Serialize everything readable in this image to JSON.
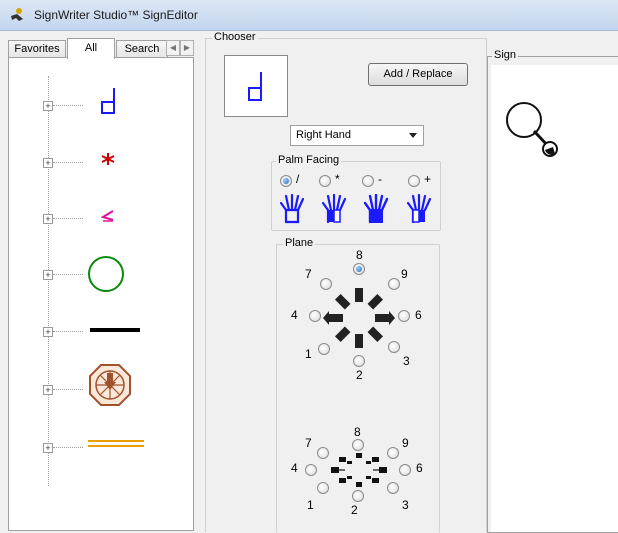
{
  "window": {
    "title": "SignWriter Studio™ SignEditor",
    "icon": "signwriter-app-icon"
  },
  "tabs": {
    "favorites": "Favorites",
    "all": "All",
    "search": "Search",
    "active": "All"
  },
  "symbol_tree": {
    "items": [
      {
        "name": "hand-symbol",
        "color": "#1a1aff"
      },
      {
        "name": "movement-symbol",
        "color": "#cc0000"
      },
      {
        "name": "dynamics-symbol",
        "color": "#e0149c"
      },
      {
        "name": "head-symbol",
        "color": "#0a8a0a"
      },
      {
        "name": "body-symbol",
        "color": "#000000"
      },
      {
        "name": "detailed-location-symbol",
        "color": "#a0522d"
      },
      {
        "name": "punctuation-symbol",
        "color": "#e8a000"
      }
    ]
  },
  "chooser": {
    "label": "Chooser",
    "add_replace_label": "Add / Replace",
    "hand_select": {
      "value": "Right Hand"
    },
    "palm_facing": {
      "label": "Palm Facing",
      "options": [
        {
          "label": "/",
          "selected": true
        },
        {
          "label": "*",
          "selected": false
        },
        {
          "label": "-",
          "selected": false
        },
        {
          "label": "+",
          "selected": false
        }
      ]
    },
    "plane": {
      "label": "Plane",
      "wall": {
        "numbers": [
          "8",
          "9",
          "6",
          "3",
          "2",
          "1",
          "4",
          "7"
        ],
        "selected": "8"
      },
      "floor": {
        "numbers": [
          "8",
          "9",
          "6",
          "3",
          "2",
          "1",
          "4",
          "7"
        ]
      }
    }
  },
  "sign": {
    "label": "Sign"
  },
  "colors": {
    "hand_blue": "#1a1aff",
    "selection_blue": "#1f63b8"
  }
}
